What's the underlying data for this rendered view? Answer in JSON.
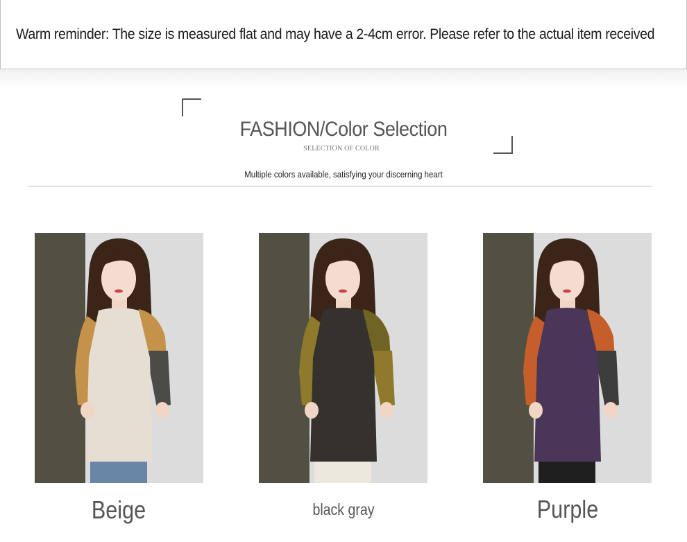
{
  "reminder": {
    "text": "Warm reminder: The size is measured flat and may have a 2-4cm error. Please refer to the actual item received"
  },
  "section": {
    "title": "FASHION/Color Selection",
    "subtitle": "SELECTION OF COLOR",
    "tagline": "Multiple colors available, satisfying your discerning heart"
  },
  "products": [
    {
      "label": "Beige",
      "icon": "sweater-photo-beige",
      "colors": {
        "body": "#e6ded2",
        "sleeve_left": "#c4924a",
        "sleeve_right": "#4b4b48",
        "shoulder_right": "#c4924a",
        "wall": "#525043",
        "backdrop": "#dcdcdc",
        "pants": "#6a86a6"
      }
    },
    {
      "label": "black gray",
      "icon": "sweater-photo-black-gray",
      "colors": {
        "body": "#35322e",
        "sleeve_left": "#8f7a2c",
        "sleeve_right": "#8f7a2c",
        "shoulder_right": "#6f6423",
        "wall": "#525043",
        "backdrop": "#dcdcdc",
        "pants": "#ece8de"
      }
    },
    {
      "label": "Purple",
      "icon": "sweater-photo-purple",
      "colors": {
        "body": "#4a3658",
        "sleeve_left": "#c55e2b",
        "sleeve_right": "#3c3c3c",
        "shoulder_right": "#c55e2b",
        "wall": "#525043",
        "backdrop": "#dcdcdc",
        "pants": "#1f1f1f"
      }
    }
  ]
}
